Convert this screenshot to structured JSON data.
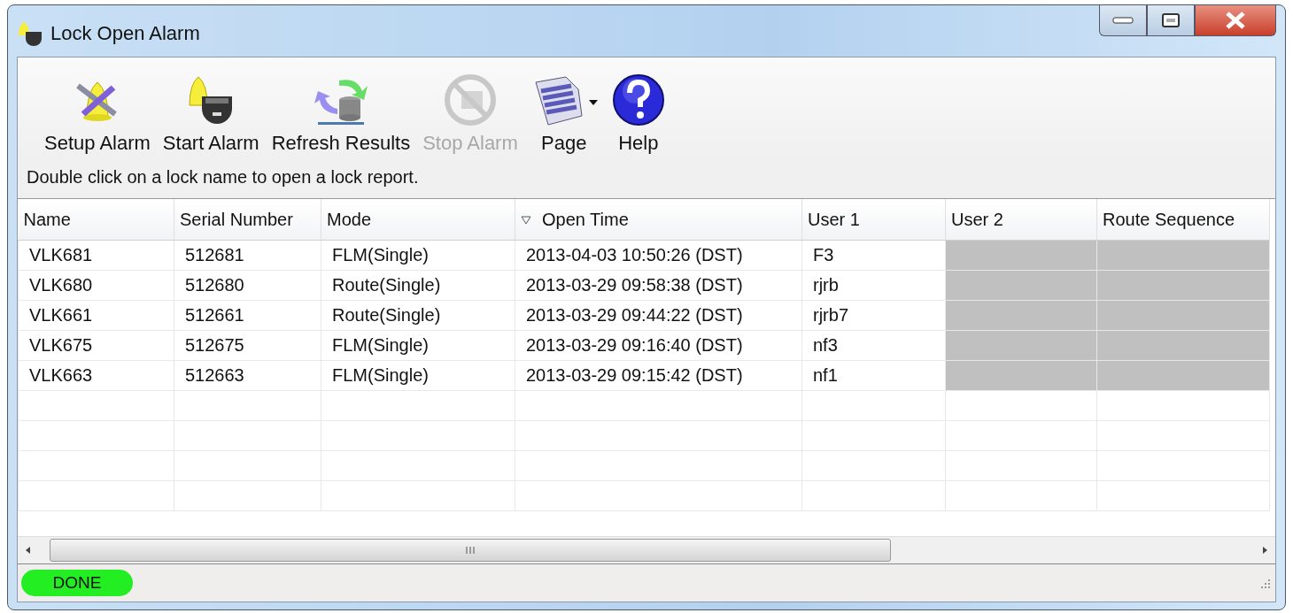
{
  "window": {
    "title": "Lock Open Alarm"
  },
  "toolbar": [
    {
      "label": "Setup Alarm",
      "kind": "setup",
      "disabled": false,
      "dropdown": false
    },
    {
      "label": "Start Alarm",
      "kind": "start",
      "disabled": false,
      "dropdown": false
    },
    {
      "label": "Refresh Results",
      "kind": "refresh",
      "disabled": false,
      "dropdown": false
    },
    {
      "label": "Stop Alarm",
      "kind": "stop",
      "disabled": true,
      "dropdown": false
    },
    {
      "label": "Page",
      "kind": "page",
      "disabled": false,
      "dropdown": true
    },
    {
      "label": "Help",
      "kind": "help",
      "disabled": false,
      "dropdown": false
    }
  ],
  "hint": "Double click on a lock name to open a lock report.",
  "table": {
    "columns": [
      {
        "label": "Name",
        "sorted": false
      },
      {
        "label": "Serial Number",
        "sorted": false
      },
      {
        "label": "Mode",
        "sorted": false
      },
      {
        "label": "Open Time",
        "sorted": true
      },
      {
        "label": "User 1",
        "sorted": false
      },
      {
        "label": "User 2",
        "sorted": false
      },
      {
        "label": "Route Sequence",
        "sorted": false
      }
    ],
    "rows": [
      {
        "cells": [
          "VLK681",
          "512681",
          "FLM(Single)",
          "2013-04-03 10:50:26 (DST)",
          "F3"
        ],
        "greyed": true
      },
      {
        "cells": [
          "VLK680",
          "512680",
          "Route(Single)",
          "2013-03-29 09:58:38 (DST)",
          "rjrb"
        ],
        "greyed": true
      },
      {
        "cells": [
          "VLK661",
          "512661",
          "Route(Single)",
          "2013-03-29 09:44:22 (DST)",
          "rjrb7"
        ],
        "greyed": true
      },
      {
        "cells": [
          "VLK675",
          "512675",
          "FLM(Single)",
          "2013-03-29 09:16:40 (DST)",
          "nf3"
        ],
        "greyed": true
      },
      {
        "cells": [
          "VLK663",
          "512663",
          "FLM(Single)",
          "2013-03-29 09:15:42 (DST)",
          "nf1"
        ],
        "greyed": true
      }
    ]
  },
  "status_bar": {
    "status": "DONE"
  }
}
